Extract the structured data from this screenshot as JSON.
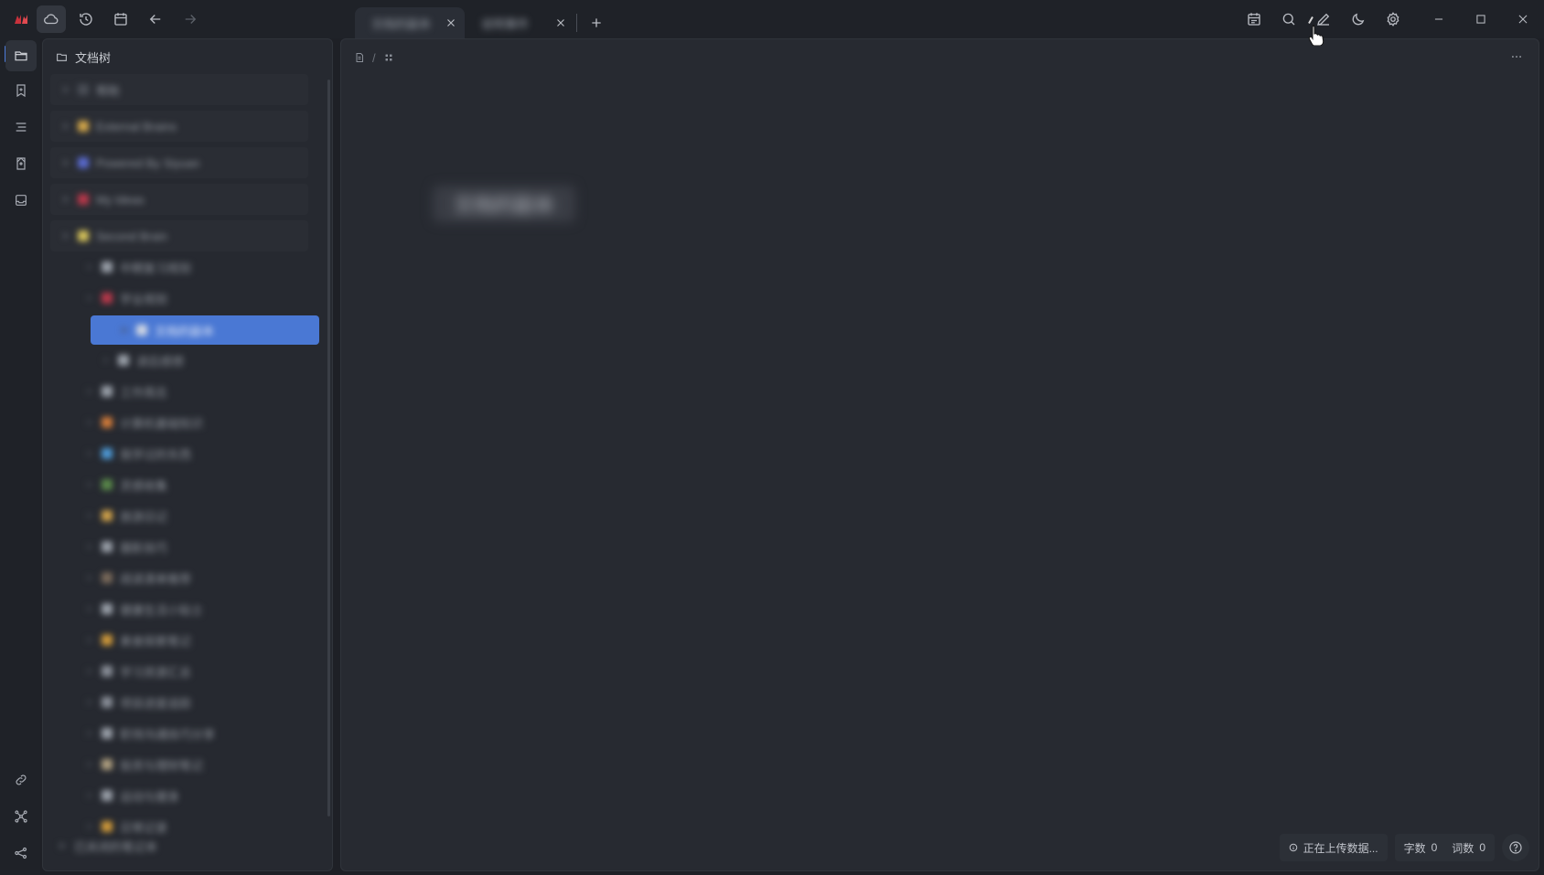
{
  "titlebar": {
    "tabs": [
      {
        "label": "文档的副本",
        "active": true
      },
      {
        "label": "说明事件",
        "active": false
      }
    ]
  },
  "icons": {
    "logo": "siyuan-logo-icon",
    "sync": "cloud-icon",
    "history": "history-icon",
    "calendar": "calendar-icon",
    "back": "arrow-left-icon",
    "forward": "arrow-right-icon",
    "daily": "daily-note-icon",
    "search": "search-icon",
    "edit": "pencil-icon",
    "theme": "moon-icon",
    "settings": "gear-icon"
  },
  "sidebar": {
    "title": "文档树"
  },
  "tree": {
    "notebooks": [
      {
        "label": "帮助",
        "color": "#4a4e56"
      },
      {
        "label": "External Brains",
        "color": "#d4a84a"
      },
      {
        "label": "Powered By Siyuan",
        "color": "#5a6bd0"
      },
      {
        "label": "My Ideas",
        "color": "#b8384a"
      },
      {
        "label": "Second Brain",
        "color": "#d6c35a"
      }
    ],
    "docs": [
      {
        "label": "中期复习规划",
        "color": "#9aa0a9"
      },
      {
        "label": "学业规划",
        "color": "#b8384a"
      },
      {
        "label": "文档的副本",
        "color": "#d0d6e2"
      },
      {
        "label": "读后感想",
        "color": "#9aa0a9"
      },
      {
        "label": "工作周志",
        "color": "#9aa0a9"
      },
      {
        "label": "计算机基础知识",
        "color": "#d27b3a"
      },
      {
        "label": "我学过的东西",
        "color": "#4e9ad6"
      },
      {
        "label": "灵感收集",
        "color": "#5a8a4a"
      },
      {
        "label": "旅游日记",
        "color": "#d0a24a"
      },
      {
        "label": "摄影技巧",
        "color": "#9aa0a9"
      },
      {
        "label": "阅读清单推荐",
        "color": "#7a6a5a"
      },
      {
        "label": "健康生活小贴士",
        "color": "#9aa0a9"
      },
      {
        "label": "美食探索笔记",
        "color": "#d09a3a"
      },
      {
        "label": "学习资源汇总",
        "color": "#8a8f98"
      },
      {
        "label": "项目进度追踪",
        "color": "#8a8f98"
      },
      {
        "label": "职场沟通技巧分享",
        "color": "#9aa0a9"
      },
      {
        "label": "投资与理财笔记",
        "color": "#b0a080"
      },
      {
        "label": "运动与健身",
        "color": "#9aa0a9"
      },
      {
        "label": "日常记录",
        "color": "#d09a3a"
      }
    ],
    "footer": "已关闭的笔记本"
  },
  "editor": {
    "title": "文档的副本"
  },
  "status": {
    "upload": "正在上传数据...",
    "chars_label": "字数",
    "chars_value": "0",
    "words_label": "词数",
    "words_value": "0"
  }
}
